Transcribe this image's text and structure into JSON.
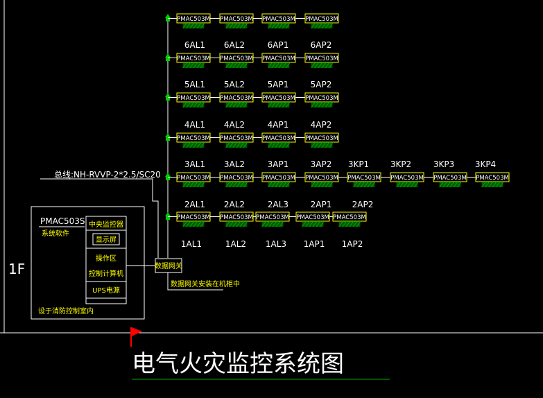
{
  "colors": {
    "background": "#000000",
    "device_outline": "#ffff00",
    "device_text": "#ffffff",
    "terminal": "#00cc00",
    "hatch": "#00aa00",
    "label": "#ffffff",
    "wire": "#ffffff",
    "flag": "#ff0000",
    "title_underline": "#00aa00",
    "frame": "#ffffff"
  },
  "device_model": "PMAC503M",
  "floor_label": "1F",
  "bus_cable": "总线:NH-RVVP-2*2.5/SC20",
  "panel": {
    "software_title": "PMAC503S",
    "software_subtitle": "系统软件",
    "cells": [
      "中央监控器",
      "显示屏",
      "操作区",
      "控制计算机",
      "UPS电源"
    ],
    "location_note": "设于消防控制室内"
  },
  "gateway": {
    "label": "数据网关",
    "note": "数据网关安装在机柜中"
  },
  "rows": [
    {
      "devices": [
        "PMAC503M",
        "PMAC503M",
        "PMAC503M",
        "PMAC503M"
      ],
      "labels": [
        "6AL1",
        "6AL2",
        "6AP1",
        "6AP2"
      ]
    },
    {
      "devices": [
        "PMAC503M",
        "PMAC503M",
        "PMAC503M",
        "PMAC503M"
      ],
      "labels": [
        "5AL1",
        "5AL2",
        "5AP1",
        "5AP2"
      ]
    },
    {
      "devices": [
        "PMAC503M",
        "PMAC503M",
        "PMAC503M",
        "PMAC503M"
      ],
      "labels": [
        "4AL1",
        "4AL2",
        "4AP1",
        "4AP2"
      ]
    },
    {
      "devices": [
        "PMAC503M",
        "PMAC503M",
        "PMAC503M",
        "PMAC503M"
      ],
      "labels": [
        "3AL1",
        "3AL2",
        "3AP1",
        "3AP2"
      ]
    },
    {
      "devices": [
        "PMAC503M",
        "PMAC503M",
        "PMAC503M",
        "PMAC503M",
        "PMAC503M",
        "PMAC503M",
        "PMAC503M",
        "PMAC503M"
      ],
      "labels": [
        "2AL1",
        "2AL2",
        "2AL3",
        "2AP1",
        "2AP2"
      ],
      "top_labels": [
        "3AL1",
        "3AL2",
        "3AP1",
        "3AP2",
        "3KP1",
        "3KP2",
        "3KP3",
        "3KP4"
      ]
    },
    {
      "devices": [
        "PMAC503M",
        "PMAC503M",
        "PMAC503M",
        "PMAC503M",
        "PMAC503M"
      ],
      "labels": [
        "1AL1",
        "1AL2",
        "1AL3",
        "1AP1",
        "1AP2"
      ]
    }
  ],
  "title": "电气火灾监控系统图"
}
